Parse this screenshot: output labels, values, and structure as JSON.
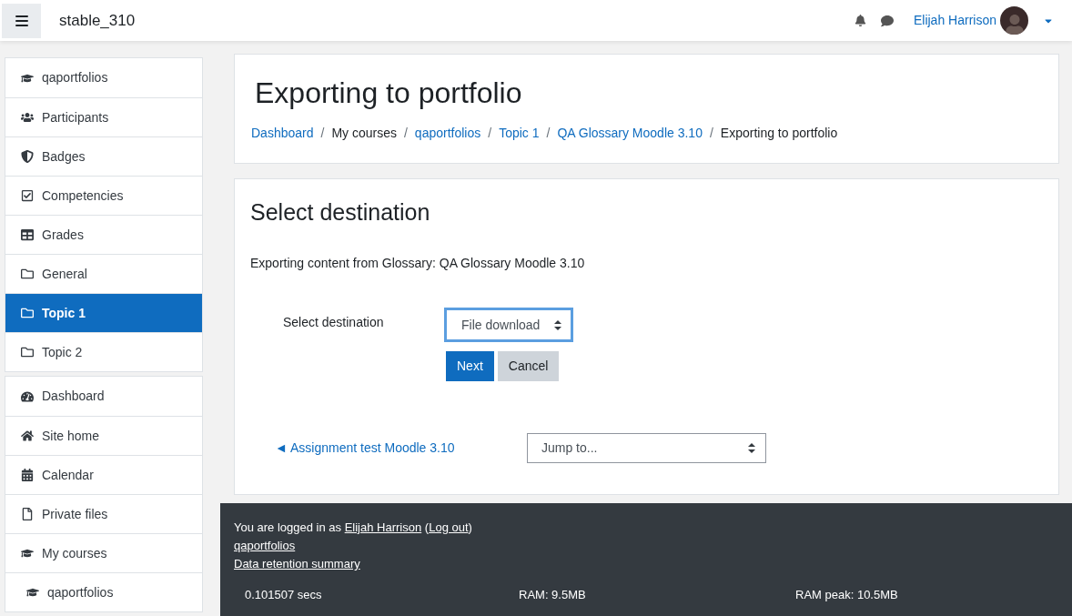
{
  "navbar": {
    "site_name": "stable_310",
    "user_name": "Elijah Harrison"
  },
  "sidebar": {
    "groups": [
      {
        "items": [
          {
            "label": "qaportfolios",
            "kind": "course",
            "selected": false
          },
          {
            "label": "Participants",
            "kind": "people",
            "selected": false
          },
          {
            "label": "Badges",
            "kind": "badge",
            "selected": false
          },
          {
            "label": "Competencies",
            "kind": "checklist",
            "selected": false
          },
          {
            "label": "Grades",
            "kind": "grid",
            "selected": false
          },
          {
            "label": "General",
            "kind": "section",
            "selected": false
          },
          {
            "label": "Topic 1",
            "kind": "section",
            "selected": true
          },
          {
            "label": "Topic 2",
            "kind": "section",
            "selected": false
          }
        ]
      },
      {
        "items": [
          {
            "label": "Dashboard",
            "kind": "dashboard",
            "selected": false
          },
          {
            "label": "Site home",
            "kind": "home",
            "selected": false
          },
          {
            "label": "Calendar",
            "kind": "calendar",
            "selected": false
          },
          {
            "label": "Private files",
            "kind": "file",
            "selected": false
          },
          {
            "label": "My courses",
            "kind": "courses",
            "selected": false
          },
          {
            "label": "qaportfolios",
            "kind": "subcourse",
            "selected": false
          }
        ]
      }
    ]
  },
  "page_header": {
    "title": "Exporting to portfolio",
    "separator": "/",
    "breadcrumb": [
      {
        "label": "Dashboard",
        "kind": "link"
      },
      {
        "label": "My courses",
        "kind": "text"
      },
      {
        "label": "qaportfolios",
        "kind": "link"
      },
      {
        "label": "Topic 1",
        "kind": "link"
      },
      {
        "label": "QA Glossary Moodle 3.10",
        "kind": "link"
      },
      {
        "label": "Exporting to portfolio",
        "kind": "text"
      }
    ]
  },
  "content": {
    "heading": "Select destination",
    "intro": "Exporting content from Glossary: QA Glossary Moodle 3.10",
    "form": {
      "label": "Select destination",
      "select_value": "File download",
      "focused": true,
      "buttons": [
        {
          "label": "Next",
          "kind": "primary"
        },
        {
          "label": "Cancel",
          "kind": "secondary"
        }
      ]
    },
    "prev_link": "◄ Assignment test Moodle 3.10",
    "jump_select": "Jump to..."
  },
  "footer": {
    "logged_in": [
      {
        "text": "You are logged in as ",
        "kind": "text"
      },
      {
        "text": "Elijah Harrison",
        "kind": "link"
      },
      {
        "text": " (",
        "kind": "text"
      },
      {
        "text": "Log out",
        "kind": "link"
      },
      {
        "text": ")",
        "kind": "text"
      }
    ],
    "links": [
      "qaportfolios",
      "Data retention summary"
    ],
    "stats": [
      "0.101507 secs",
      "RAM: 9.5MB",
      "RAM peak: 10.5MB"
    ]
  }
}
